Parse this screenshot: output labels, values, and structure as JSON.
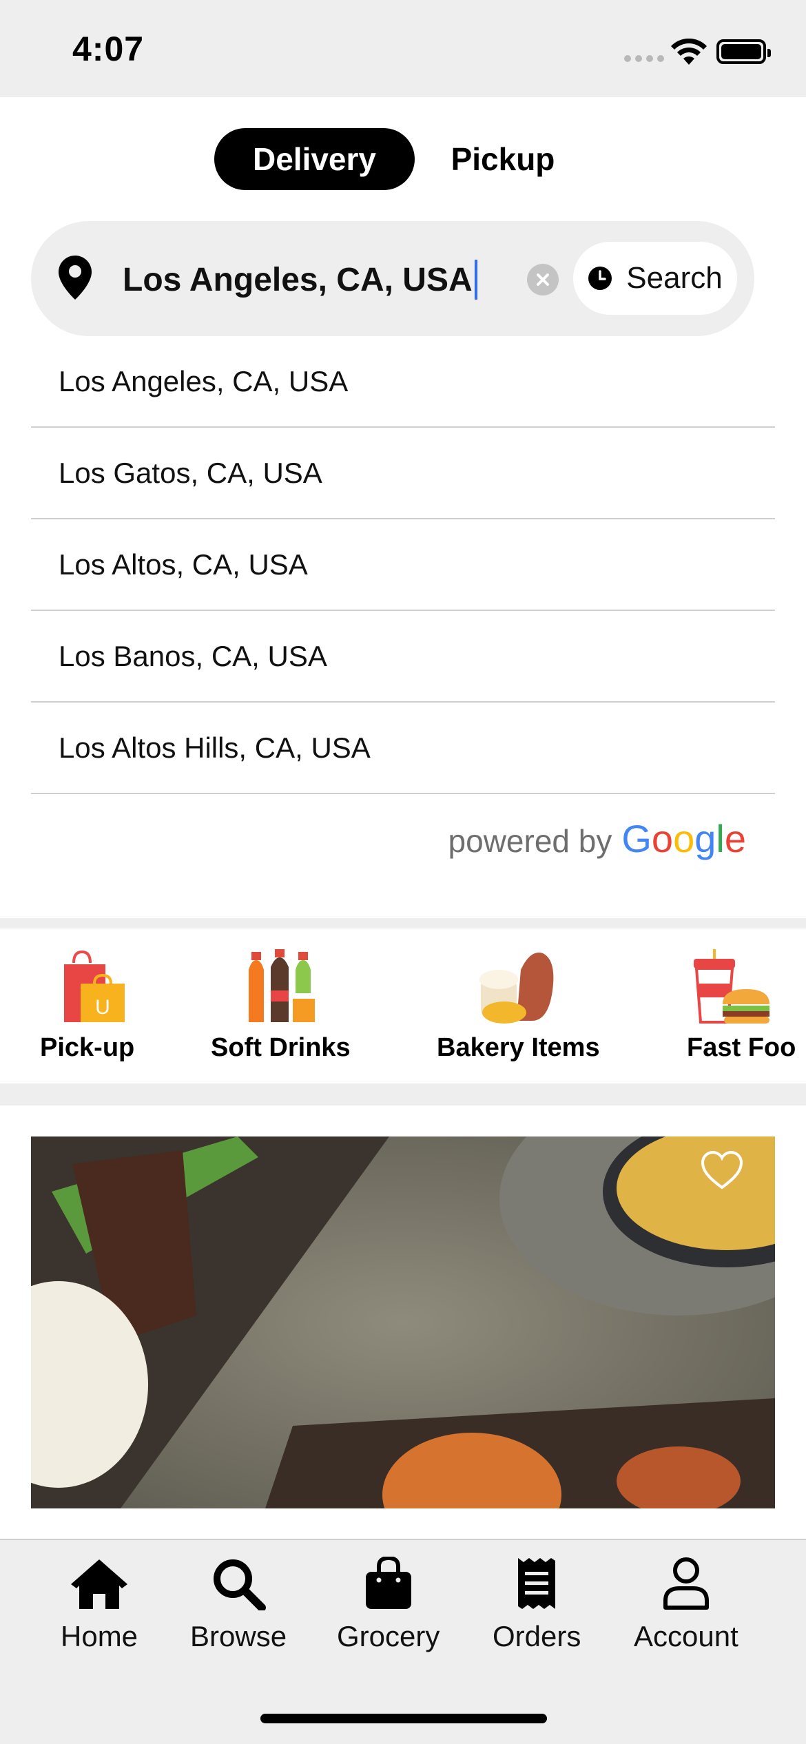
{
  "status_bar": {
    "time": "4:07"
  },
  "mode_toggle": {
    "delivery_label": "Delivery",
    "pickup_label": "Pickup",
    "selected": "Delivery"
  },
  "search": {
    "value": "Los Angeles, CA, USA",
    "button_label": "Search"
  },
  "suggestions": [
    "Los Angeles, CA, USA",
    "Los Gatos, CA, USA",
    "Los Altos, CA, USA",
    "Los Banos, CA, USA",
    "Los Altos Hills, CA, USA"
  ],
  "attribution": {
    "powered_by": "powered by",
    "brand": "Google"
  },
  "categories": [
    {
      "label": "Pick-up",
      "icon": "shopping-bags-icon"
    },
    {
      "label": "Soft Drinks",
      "icon": "soda-bottles-icon"
    },
    {
      "label": "Bakery Items",
      "icon": "bread-icon"
    },
    {
      "label": "Fast Foo",
      "icon": "fast-food-icon"
    }
  ],
  "tabbar": [
    {
      "label": "Home",
      "icon": "home-icon"
    },
    {
      "label": "Browse",
      "icon": "search-icon"
    },
    {
      "label": "Grocery",
      "icon": "shopping-bag-icon"
    },
    {
      "label": "Orders",
      "icon": "receipt-icon"
    },
    {
      "label": "Account",
      "icon": "person-icon"
    }
  ],
  "colors": {
    "accent": "#000000",
    "background": "#eeeeee",
    "caret": "#2f6bff"
  }
}
